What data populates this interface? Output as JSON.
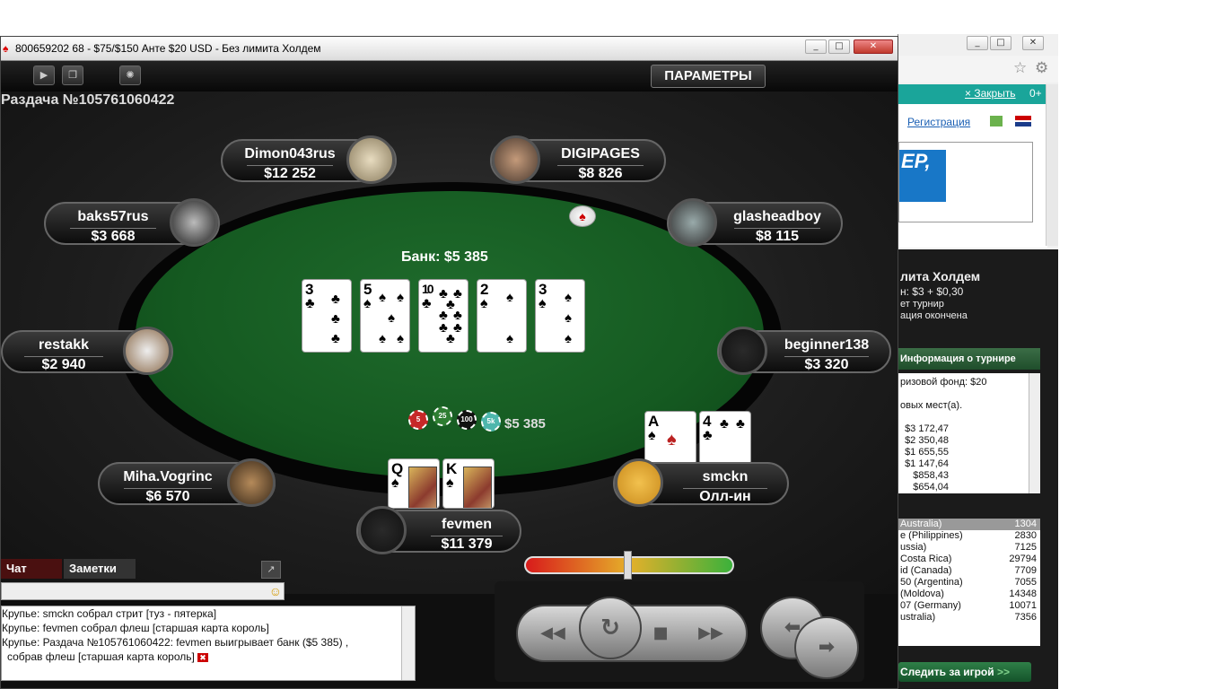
{
  "window": {
    "title": "800659202 68 - $75/$150 Анте $20 USD - Без лимита Холдем",
    "params_label": "ПАРАМЕТРЫ",
    "hand_number": "Раздача №105761060422"
  },
  "table": {
    "pot_label": "Банк: $5 385",
    "chip_total": "$5 385",
    "board": [
      {
        "rank": "3",
        "suit": "♣"
      },
      {
        "rank": "5",
        "suit": "♠"
      },
      {
        "rank": "10",
        "suit": "♣"
      },
      {
        "rank": "2",
        "suit": "♠"
      },
      {
        "rank": "3",
        "suit": "♠"
      }
    ],
    "chips": [
      "5",
      "25",
      "100",
      "5k"
    ]
  },
  "players": {
    "dimon": {
      "name": "Dimon043rus",
      "stack": "$12 252"
    },
    "digipages": {
      "name": "DIGIPAGES",
      "stack": "$8 826"
    },
    "baks": {
      "name": "baks57rus",
      "stack": "$3 668"
    },
    "glasheadboy": {
      "name": "glasheadboy",
      "stack": "$8 115"
    },
    "restakk": {
      "name": "restakk",
      "stack": "$2 940"
    },
    "beginner": {
      "name": "beginner138",
      "stack": "$3 320"
    },
    "miha": {
      "name": "Miha.Vogrinc",
      "stack": "$6 570"
    },
    "smckn": {
      "name": "smckn",
      "stack": "Олл-ин",
      "cards": [
        {
          "rank": "A",
          "suit": "♠"
        },
        {
          "rank": "4",
          "suit": "♣"
        }
      ]
    },
    "fevmen": {
      "name": "fevmen",
      "stack": "$11 379",
      "cards": [
        {
          "rank": "Q",
          "suit": "♠"
        },
        {
          "rank": "K",
          "suit": "♠"
        }
      ]
    }
  },
  "chat": {
    "tab_chat": "Чат",
    "tab_notes": "Заметки",
    "lines": [
      "Крупье: smckn собрал стрит [туз - пятерка]",
      "Крупье: fevmen собрал флеш [старшая карта король]",
      "Крупье: Раздача №105761060422: fevmen выигрывает банк ($5 385) ,",
      "собрав флеш [старшая карта король]"
    ]
  },
  "lobby": {
    "close_label": "× Закрыть",
    "age_label": "0+",
    "register_link": "Регистрация",
    "banner_text": "EP,",
    "game_title": "лита Холдем",
    "buyin": "н: $3 + $0,30",
    "line_tournament": "ет турнир",
    "line_finished": "ация окончена",
    "info_header": "Информация о турнире",
    "prize_pool": "ризовой фонд: $20",
    "places": "овых мест(а).",
    "prizes": [
      "$3 172,47",
      "$2 350,48",
      "$1 655,55",
      "$1 147,64",
      "$858,43",
      "$654,04"
    ],
    "players_table": [
      {
        "name": "Australia)",
        "value": "1304"
      },
      {
        "name": "e (Philippines)",
        "value": "2830"
      },
      {
        "name": "ussia)",
        "value": "7125"
      },
      {
        "name": "Costa Rica)",
        "value": "29794"
      },
      {
        "name": "id (Canada)",
        "value": "7709"
      },
      {
        "name": "50 (Argentina)",
        "value": "7055"
      },
      {
        "name": "(Moldova)",
        "value": "14348"
      },
      {
        "name": "07 (Germany)",
        "value": "10071"
      },
      {
        "name": "ustralia)",
        "value": "7356"
      }
    ],
    "follow_label": "Следить за игрой"
  },
  "colors": {
    "felt": "#1a6328",
    "teal": "#1aa59a",
    "info_green": "#2f6a3d"
  }
}
